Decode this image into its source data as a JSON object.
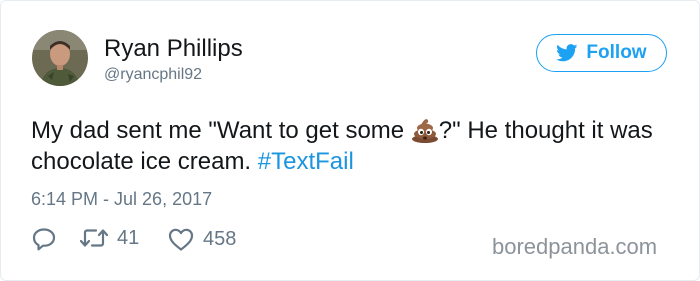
{
  "user": {
    "name": "Ryan Phillips",
    "handle": "@ryancphil92",
    "avatar": "avatar-photo"
  },
  "follow_button": {
    "label": "Follow",
    "icon": "twitter-bird-icon",
    "color": "#1da1f2"
  },
  "tweet": {
    "text_before_emoji": "My dad sent me \"Want to get some ",
    "emoji": "pile-of-poo-emoji",
    "text_after_emoji": "?\" He thought it was chocolate ice cream. ",
    "hashtag": "#TextFail",
    "timestamp": "6:14 PM - Jul 26, 2017",
    "hashtag_color": "#1b95e0"
  },
  "actions": {
    "reply": {
      "icon": "reply-icon"
    },
    "retweet": {
      "icon": "retweet-icon",
      "count": "41"
    },
    "like": {
      "icon": "heart-icon",
      "count": "458"
    }
  },
  "watermark": "boredpanda.com"
}
